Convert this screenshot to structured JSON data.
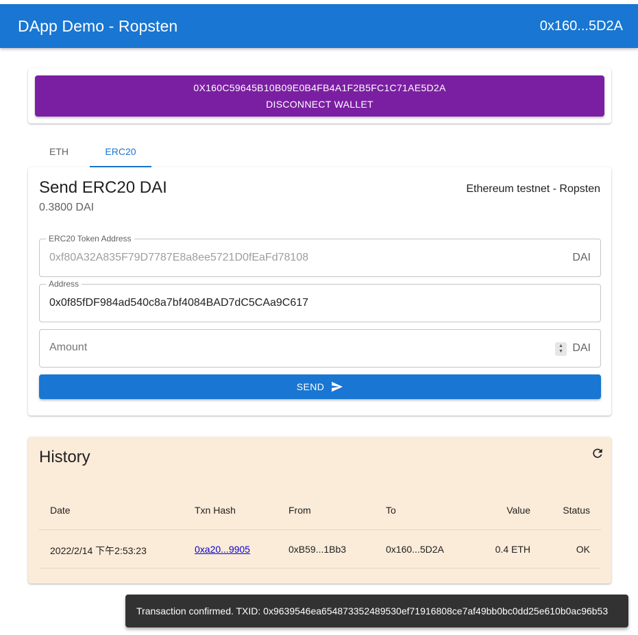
{
  "appbar": {
    "title": "DApp Demo - Ropsten",
    "account_short": "0x160...5D2A"
  },
  "wallet": {
    "address": "0X160C59645B10B09E0B4FB4A1F2B5FC1C71AE5D2A",
    "disconnect_label": "DISCONNECT WALLET"
  },
  "tabs": [
    {
      "label": "ETH",
      "active": false
    },
    {
      "label": "ERC20",
      "active": true
    }
  ],
  "send": {
    "title": "Send ERC20 DAI",
    "network": "Ethereum testnet - Ropsten",
    "balance": "0.3800 DAI",
    "token_field": {
      "label": "ERC20 Token Address",
      "value": "0xf80A32A835F79D7787E8a8ee5721D0fEaFd78108",
      "unit": "DAI"
    },
    "address_field": {
      "label": "Address",
      "value": "0x0f85fDF984ad540c8a7bf4084BAD7dC5CAa9C617"
    },
    "amount_field": {
      "placeholder": "Amount",
      "unit": "DAI"
    },
    "send_label": "SEND"
  },
  "history": {
    "title": "History",
    "columns": {
      "date": "Date",
      "hash": "Txn Hash",
      "from": "From",
      "to": "To",
      "value": "Value",
      "status": "Status"
    },
    "rows": [
      {
        "date": "2022/2/14 下午2:53:23",
        "hash": "0xa20...9905",
        "from": "0xB59...1Bb3",
        "to": "0x160...5D2A",
        "value": "0.4 ETH",
        "status": "OK"
      }
    ]
  },
  "toast": {
    "message": "Transaction confirmed. TXID: 0x9639546ea654873352489530ef71916808ce7af49bb0bc0dd25e610b0ac96b53"
  },
  "colors": {
    "primary": "#1976d2",
    "wallet_button": "#7b1fa2",
    "history_bg": "#fbebd9",
    "toast_bg": "#323232"
  },
  "icons": {
    "send": "send-arrow-icon",
    "refresh": "refresh-icon"
  }
}
